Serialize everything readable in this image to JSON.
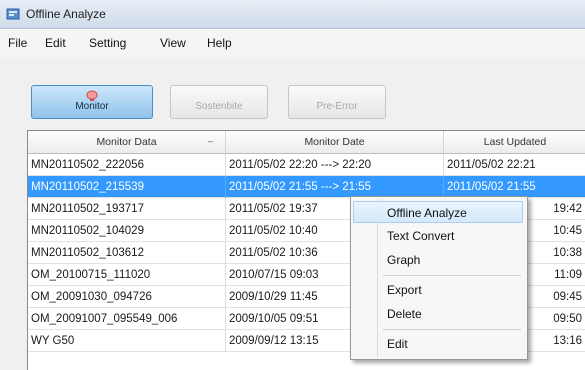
{
  "window": {
    "title": "Offline Analyze"
  },
  "menu": [
    "File",
    "Edit",
    "Setting",
    "View",
    "Help"
  ],
  "toolbar": {
    "buttons": [
      {
        "label": "Monitor",
        "state": "active",
        "icon": "monitor-icon"
      },
      {
        "label": "Sostenbite",
        "state": "disabled",
        "icon": ""
      },
      {
        "label": "Pre-Error",
        "state": "disabled",
        "icon": ""
      }
    ]
  },
  "table": {
    "columns": [
      "Monitor Data",
      "Monitor Date",
      "Last Updated"
    ],
    "sort_column": "Monitor Data",
    "rows": [
      {
        "data": "MN20110502_222056",
        "date": "2011/05/02 22:20 ---> 22:20",
        "updated": "2011/05/02 22:21",
        "selected": false
      },
      {
        "data": "MN20110502_215539",
        "date": "2011/05/02 21:55 ---> 21:55",
        "updated": "2011/05/02 21:55",
        "selected": true
      },
      {
        "data": "MN20110502_193717",
        "date": "2011/05/02 19:37",
        "updated": "19:42",
        "selected": false
      },
      {
        "data": "MN20110502_104029",
        "date": "2011/05/02 10:40",
        "updated": "10:45",
        "selected": false
      },
      {
        "data": "MN20110502_103612",
        "date": "2011/05/02 10:36",
        "updated": "10:38",
        "selected": false
      },
      {
        "data": "OM_20100715_111020",
        "date": "2010/07/15 09:03",
        "updated": "11:09",
        "selected": false
      },
      {
        "data": "OM_20091030_094726",
        "date": "2009/10/29 11:45",
        "updated": "09:45",
        "selected": false
      },
      {
        "data": "OM_20091007_095549_006",
        "date": "2009/10/05 09:51",
        "updated": "09:50",
        "selected": false
      },
      {
        "data": "WY G50",
        "date": "2009/09/12 13:15",
        "updated": "13:16",
        "selected": false
      }
    ]
  },
  "context_menu": {
    "items": [
      "Offline Analyze",
      "Text Convert",
      "Graph",
      "Export",
      "Delete",
      "Edit"
    ],
    "hover_index": 0
  },
  "colors": {
    "selection": "#3399ff",
    "active_button": "#8fc3ec",
    "menu_hover": "#d4e8fb"
  }
}
